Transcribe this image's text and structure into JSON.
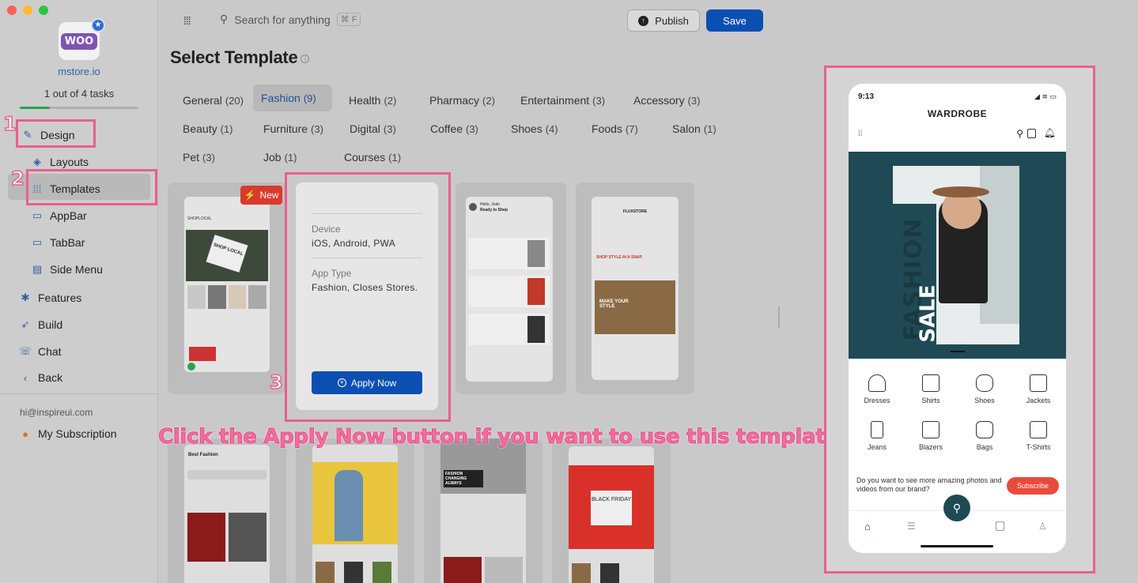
{
  "sidebar": {
    "store_name": "mstore.io",
    "logo_text": "WOO",
    "tasks": "1 out of 4 tasks",
    "progress": 0.25,
    "items": [
      {
        "label": "Design",
        "icon": "brush-icon"
      },
      {
        "label": "Layouts",
        "icon": "layers-icon"
      },
      {
        "label": "Templates",
        "icon": "grid-icon"
      },
      {
        "label": "AppBar",
        "icon": "appbar-icon"
      },
      {
        "label": "TabBar",
        "icon": "tabbar-icon"
      },
      {
        "label": "Side Menu",
        "icon": "sidemenu-icon"
      },
      {
        "label": "Features",
        "icon": "features-icon"
      },
      {
        "label": "Build",
        "icon": "rocket-icon"
      },
      {
        "label": "Chat",
        "icon": "chat-icon"
      },
      {
        "label": "Back",
        "icon": "chevron-left-icon"
      }
    ],
    "email": "hi@inspireui.com",
    "subscription": "My Subscription"
  },
  "steps": {
    "one": "1",
    "two": "2",
    "three": "3"
  },
  "topbar": {
    "search_placeholder": "Search for anything",
    "shortcut": "⌘ F",
    "publish_label": "Publish",
    "save_label": "Save"
  },
  "page_title": "Select Template",
  "categories": [
    {
      "name": "General",
      "count": "(20)"
    },
    {
      "name": "Fashion",
      "count": "(9)"
    },
    {
      "name": "Health",
      "count": "(2)"
    },
    {
      "name": "Pharmacy",
      "count": "(2)"
    },
    {
      "name": "Entertainment",
      "count": "(3)"
    },
    {
      "name": "Accessory",
      "count": "(3)"
    },
    {
      "name": "Beauty",
      "count": "(1)"
    },
    {
      "name": "Furniture",
      "count": "(3)"
    },
    {
      "name": "Digital",
      "count": "(3)"
    },
    {
      "name": "Coffee",
      "count": "(3)"
    },
    {
      "name": "Shoes",
      "count": "(4)"
    },
    {
      "name": "Foods",
      "count": "(7)"
    },
    {
      "name": "Salon",
      "count": "(1)"
    },
    {
      "name": "Pet",
      "count": "(3)"
    },
    {
      "name": "Job",
      "count": "(1)"
    },
    {
      "name": "Courses",
      "count": "(1)"
    }
  ],
  "badge_new": "New",
  "detail": {
    "device_label": "Device",
    "device_value": "iOS, Android, PWA",
    "apptype_label": "App Type",
    "apptype_value": "Fashion, Closes Stores.",
    "apply_label": "Apply Now"
  },
  "thumbs": {
    "t1_brand": "SHOPLOCAL",
    "t1_sign": "SHOP LOCAL",
    "t3_greeting": "Hello, Jodo",
    "t3_sub": "Ready to Shop",
    "t4_brand": "FLUXSTORE",
    "t4_heading": "SHOP STYLE IN A SNAP",
    "t4_banner": "MAKE YOUR STYLE",
    "b1_title": "Best Fashion",
    "b3_promo": "FASHION CHANGING ALWAYS",
    "b4_sale": "BLACK FRIDAY"
  },
  "banner": "Click the Apply Now button if you want to use this template",
  "preview": {
    "time": "9:13",
    "title": "WARDROBE",
    "poster_big": "FASHION",
    "poster_sale": "SALE",
    "categories": [
      "Dresses",
      "Shirts",
      "Shoes",
      "Jackets",
      "Jeans",
      "Blazers",
      "Bags",
      "T-Shirts"
    ],
    "promo_text": "Do you want to see more amazing photos and videos from our brand?",
    "subscribe_label": "Subscribe"
  },
  "colors": {
    "accent": "#0b4fb3",
    "highlight": "#e9608c",
    "hero": "#1f4a55"
  }
}
